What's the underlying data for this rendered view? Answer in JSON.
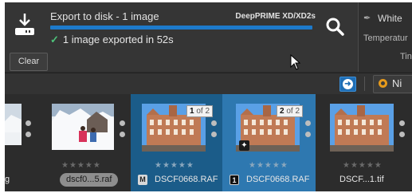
{
  "export": {
    "title": "Export to disk - 1 image",
    "engine": "DeepPRIME XD/XD2s",
    "progress": 1.0,
    "status_check": "✓",
    "status": "1 image exported in 52s",
    "clear_label": "Clear"
  },
  "settings": {
    "white_balance": "White",
    "temperature": "Temperatur",
    "tint": "Tin"
  },
  "toolbar": {
    "nav_arrow": "➜",
    "nik_label": "Ni"
  },
  "filmstrip": {
    "stars": "★★★★★",
    "items": [
      {
        "name": "g",
        "kind": "cut"
      },
      {
        "name": "dscf0...5.raf",
        "kind": "snow"
      },
      {
        "name": "DSCF0668.RAF",
        "badge": "M",
        "count_num": "1",
        "count_of": "of 2",
        "selected": true
      },
      {
        "name": "DSCF0668.RAF",
        "badge": "1",
        "count_num": "2",
        "count_of": "of 2",
        "selected": true,
        "active": true
      },
      {
        "name": "DSCF...1.tif"
      }
    ]
  },
  "colors": {
    "accent": "#1d7acb",
    "selected": "#1b5c89",
    "active": "#2e78b0",
    "success": "#4ec27a"
  }
}
